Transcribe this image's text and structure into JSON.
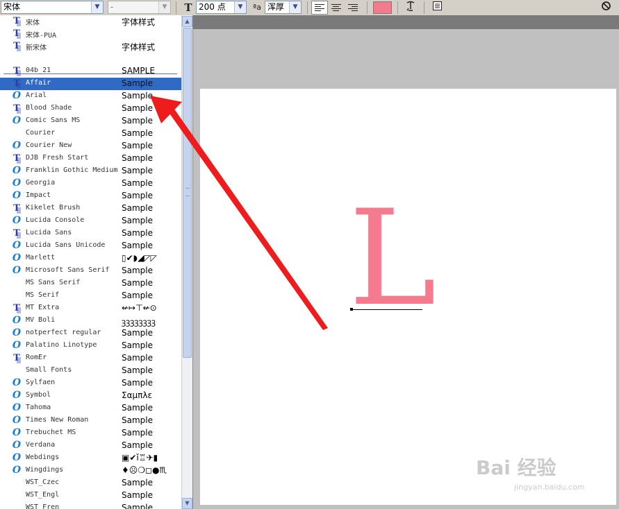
{
  "toolbar": {
    "font_family_value": "宋体",
    "font_style_value": "-",
    "font_size_value": "200 点",
    "antialias_value": "浑厚",
    "text_color": "#f47b8d",
    "icons": {
      "text_orientation": "text-orientation-icon",
      "antialias": "antialias-aa-icon",
      "align_left": "align-left-icon",
      "align_center": "align-center-icon",
      "align_right": "align-right-icon",
      "warp": "warp-text-icon",
      "panel": "character-panel-icon",
      "cancel": "cancel-icon"
    }
  },
  "font_list": {
    "cjk_fonts": [
      {
        "name": "宋体",
        "sample": "字体样式",
        "icon": "truetype-icon"
      },
      {
        "name": "宋体-PUA",
        "sample": "",
        "icon": "truetype-icon"
      },
      {
        "name": "新宋体",
        "sample": "字体样式",
        "icon": "truetype-icon"
      }
    ],
    "fonts": [
      {
        "name": "04b_21",
        "sample": "SAMPLE",
        "icon": "truetype-icon"
      },
      {
        "name": "Affair",
        "sample": "Sample",
        "icon": "truetype-icon",
        "selected": true
      },
      {
        "name": "Arial",
        "sample": "Sample",
        "icon": "opentype-icon"
      },
      {
        "name": "Blood Shade",
        "sample": "Sample",
        "icon": "truetype-icon"
      },
      {
        "name": "Comic Sans MS",
        "sample": "Sample",
        "icon": "opentype-icon"
      },
      {
        "name": "Courier",
        "sample": "Sample",
        "icon": ""
      },
      {
        "name": "Courier New",
        "sample": "Sample",
        "icon": "opentype-icon"
      },
      {
        "name": "DJB Fresh Start",
        "sample": "Sample",
        "icon": "truetype-icon"
      },
      {
        "name": "Franklin Gothic Medium",
        "sample": "Sample",
        "icon": "opentype-icon"
      },
      {
        "name": "Georgia",
        "sample": "Sample",
        "icon": "opentype-icon"
      },
      {
        "name": "Impact",
        "sample": "Sample",
        "icon": "opentype-icon"
      },
      {
        "name": "Kikelet Brush",
        "sample": "Sample",
        "icon": "truetype-icon"
      },
      {
        "name": "Lucida Console",
        "sample": "Sample",
        "icon": "opentype-icon"
      },
      {
        "name": "Lucida Sans",
        "sample": "Sample",
        "icon": "truetype-icon"
      },
      {
        "name": "Lucida Sans Unicode",
        "sample": "Sample",
        "icon": "opentype-icon"
      },
      {
        "name": "Marlett",
        "sample": "▯✔◗◢◸◸",
        "icon": "opentype-icon"
      },
      {
        "name": "Microsoft Sans Serif",
        "sample": "Sample",
        "icon": "opentype-icon"
      },
      {
        "name": "MS Sans Serif",
        "sample": "Sample",
        "icon": ""
      },
      {
        "name": "MS Serif",
        "sample": "Sample",
        "icon": ""
      },
      {
        "name": "MT Extra",
        "sample": "↚↦⊤↚⊙",
        "icon": "truetype-icon"
      },
      {
        "name": "MV Boli",
        "sample": "ꝫꝫꝫꝫꝫꝫꝫꝫ",
        "icon": "opentype-icon"
      },
      {
        "name": "notperfect regular",
        "sample": "Sample",
        "icon": "opentype-icon"
      },
      {
        "name": "Palatino Linotype",
        "sample": "Sample",
        "icon": "opentype-icon"
      },
      {
        "name": "RomEr",
        "sample": "Sample",
        "icon": "truetype-icon"
      },
      {
        "name": "Small Fonts",
        "sample": "Sample",
        "icon": ""
      },
      {
        "name": "Sylfaen",
        "sample": "Sample",
        "icon": "opentype-icon"
      },
      {
        "name": "Symbol",
        "sample": "Σαμπλε",
        "icon": "opentype-icon"
      },
      {
        "name": "Tahoma",
        "sample": "Sample",
        "icon": "opentype-icon"
      },
      {
        "name": "Times New Roman",
        "sample": "Sample",
        "icon": "opentype-icon"
      },
      {
        "name": "Trebuchet MS",
        "sample": "Sample",
        "icon": "opentype-icon"
      },
      {
        "name": "Verdana",
        "sample": "Sample",
        "icon": "opentype-icon"
      },
      {
        "name": "Webdings",
        "sample": "▣✔ǐ♖✈▮",
        "icon": "opentype-icon"
      },
      {
        "name": "Wingdings",
        "sample": "♦☹❍◻●♏",
        "icon": "opentype-icon"
      },
      {
        "name": "WST_Czec",
        "sample": "Sample",
        "icon": ""
      },
      {
        "name": "WST_Engl",
        "sample": "Sample",
        "icon": ""
      },
      {
        "name": "WST_Fren",
        "sample": "Sample",
        "icon": ""
      }
    ]
  },
  "canvas": {
    "letter": "L",
    "letter_color": "#f47b8d"
  },
  "annotation": {
    "arrow_color": "#ee1c1c"
  },
  "watermark": {
    "logo": "Bai 经验",
    "url": "jingyan.baidu.com"
  }
}
